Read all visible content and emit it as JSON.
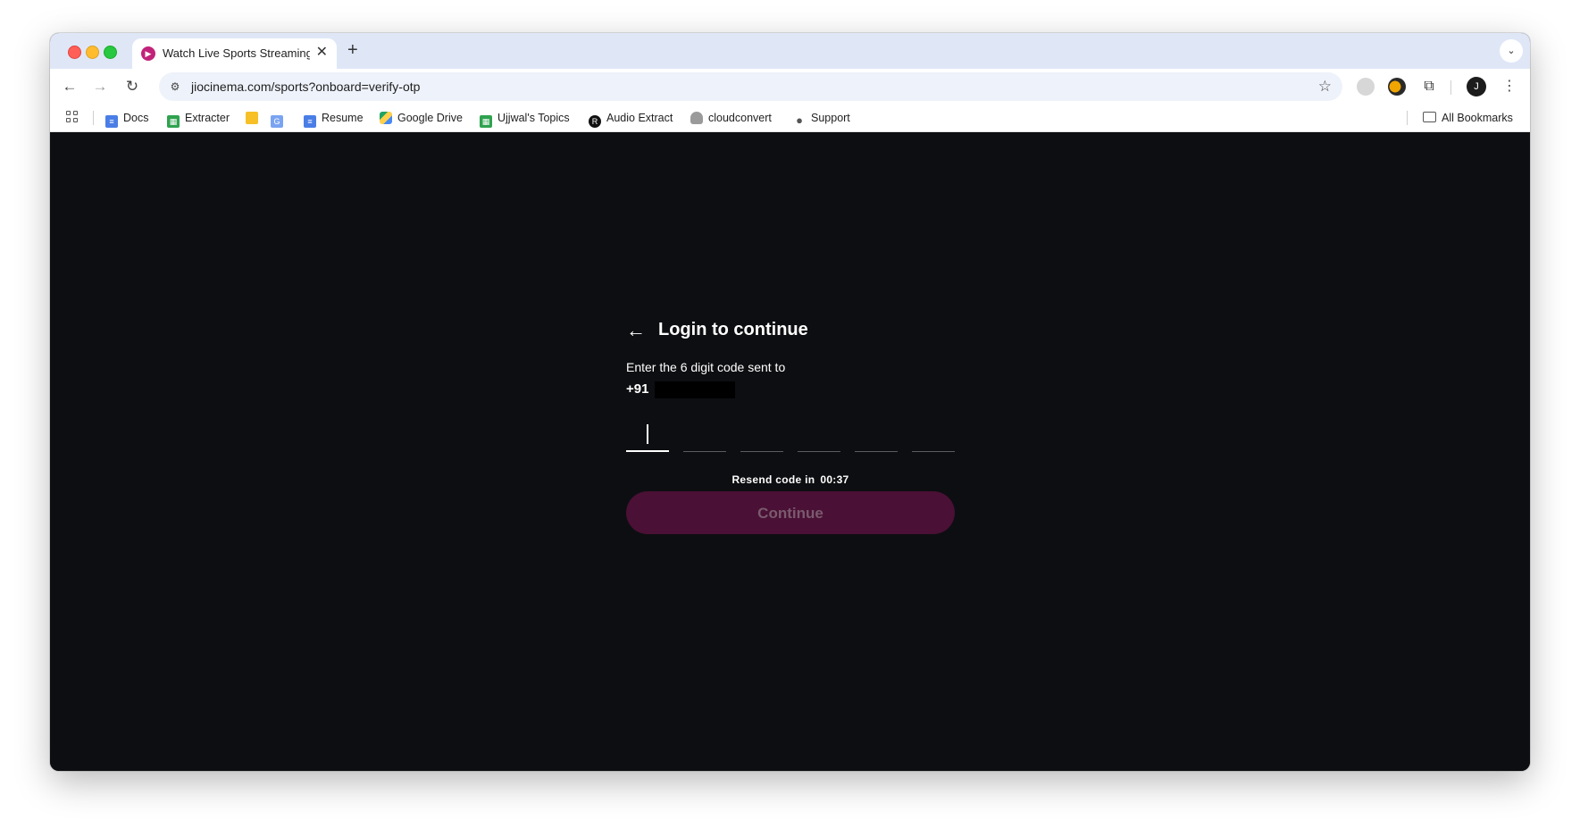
{
  "browser": {
    "tab_title": "Watch Live Sports Streaming",
    "tab_favicon": "jiocinema-icon",
    "url": "jiocinema.com/sports?onboard=verify-otp",
    "profile_initial": "J",
    "bookmarks": [
      {
        "label": "Docs",
        "icon": "docs-icon"
      },
      {
        "label": "Extracter",
        "icon": "sheets-icon"
      },
      {
        "label": "",
        "icon": "keep-icon"
      },
      {
        "label": "",
        "icon": "translate-icon"
      },
      {
        "label": "Resume",
        "icon": "docs-icon"
      },
      {
        "label": "Google Drive",
        "icon": "drive-icon"
      },
      {
        "label": "Ujjwal's Topics",
        "icon": "sheets-icon"
      },
      {
        "label": "Audio Extract",
        "icon": "r-icon"
      },
      {
        "label": "cloudconvert",
        "icon": "cloud-icon"
      },
      {
        "label": "Support",
        "icon": "apple-icon"
      }
    ],
    "all_bookmarks_label": "All Bookmarks"
  },
  "login": {
    "title": "Login to continue",
    "instructions": "Enter the 6 digit code sent to",
    "phone_prefix": "+91",
    "otp_length": 6,
    "resend_label": "Resend code in",
    "resend_timer": "00:37",
    "continue_label": "Continue"
  },
  "colors": {
    "page_background": "#0d0e11",
    "continue_button": "#4a1035",
    "continue_text": "#7a5a6e"
  }
}
